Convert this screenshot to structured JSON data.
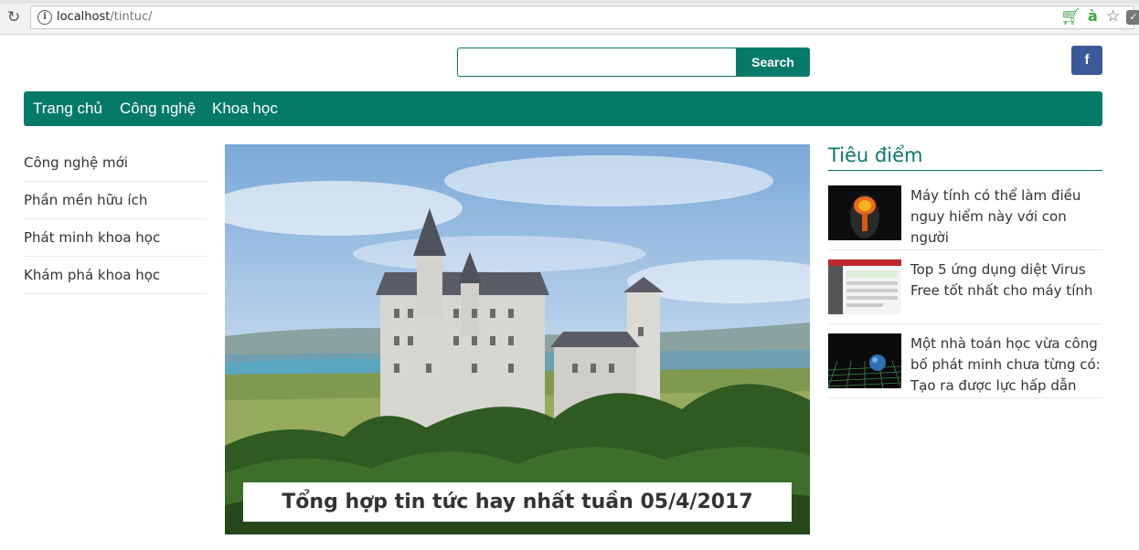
{
  "browser": {
    "url_host": "localhost",
    "url_path": "/tintuc/",
    "icons": [
      "reload-icon",
      "info-icon",
      "cart-icon",
      "translate-icon",
      "star-icon",
      "extension-icon"
    ]
  },
  "search": {
    "button_label": "Search",
    "value": ""
  },
  "social": {
    "facebook_label": "f"
  },
  "nav": {
    "items": [
      "Trang chủ",
      "Công nghệ",
      "Khoa học"
    ]
  },
  "categories": [
    "Công nghệ mới",
    "Phần mền hữu ích",
    "Phát minh khoa học",
    "Khám phá khoa học"
  ],
  "featured": {
    "caption": "Tổng hợp tin tức hay nhất tuần 05/4/2017"
  },
  "highlights": {
    "title": "Tiêu điểm",
    "items": [
      {
        "text": "Máy tính có thể làm điều nguy hiểm này với con người"
      },
      {
        "text": "Top 5 ứng dụng diệt Virus Free tốt nhất cho máy tính"
      },
      {
        "text": "Một nhà toán học vừa công bố phát minh chưa từng có: Tạo ra được lực hấp dẫn"
      }
    ]
  },
  "colors": {
    "brand": "#067a69",
    "facebook": "#3b5998"
  }
}
